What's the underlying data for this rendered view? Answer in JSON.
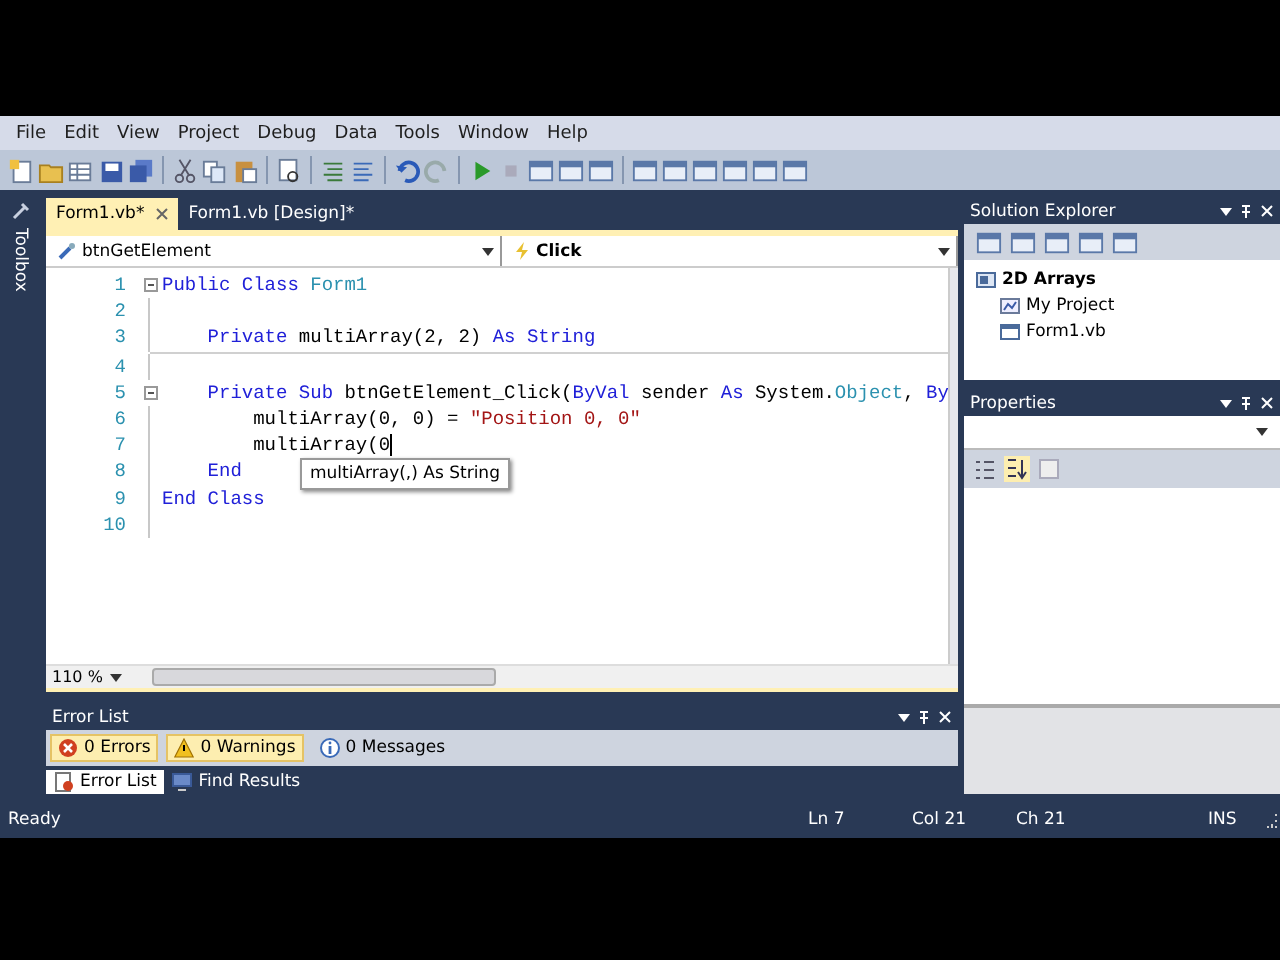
{
  "menu": [
    "File",
    "Edit",
    "View",
    "Project",
    "Debug",
    "Data",
    "Tools",
    "Window",
    "Help"
  ],
  "sidebar": {
    "title": "Toolbox"
  },
  "editor": {
    "tabs": [
      {
        "label": "Form1.vb*",
        "selected": true,
        "closable": true
      },
      {
        "label": "Form1.vb [Design]*",
        "selected": false,
        "closable": false
      }
    ],
    "object_dropdown": "btnGetElement",
    "event_dropdown": "Click",
    "lines": [
      {
        "kind": "code",
        "number": "1",
        "fold": true,
        "tokens": [
          {
            "kind": "keyword",
            "text": "Public Class "
          },
          {
            "kind": "type",
            "text": "Form1"
          }
        ]
      },
      {
        "kind": "code",
        "number": "2",
        "fold": false
      },
      {
        "kind": "code",
        "number": "3",
        "fold": false,
        "tokens": [
          {
            "kind": "keyword",
            "text": "    Private"
          },
          {
            "kind": "plain",
            "text": " multiArray(2, 2) "
          },
          {
            "kind": "keyword",
            "text": "As String"
          }
        ]
      },
      {
        "kind": "separator"
      },
      {
        "kind": "code",
        "number": "4",
        "fold": false
      },
      {
        "kind": "code",
        "number": "5",
        "fold": true,
        "tokens": [
          {
            "kind": "keyword",
            "text": "    Private Sub"
          },
          {
            "kind": "plain",
            "text": " btnGetElement_Click("
          },
          {
            "kind": "keyword",
            "text": "ByVal"
          },
          {
            "kind": "plain",
            "text": " sender "
          },
          {
            "kind": "keyword",
            "text": "As"
          },
          {
            "kind": "plain",
            "text": " System."
          },
          {
            "kind": "type",
            "text": "Object"
          },
          {
            "kind": "plain",
            "text": ", "
          },
          {
            "kind": "keyword",
            "text": "By"
          }
        ]
      },
      {
        "kind": "code",
        "number": "6",
        "fold": false,
        "tokens": [
          {
            "kind": "plain",
            "text": "        multiArray(0, 0) = "
          },
          {
            "kind": "string",
            "text": "\"Position 0, 0\""
          }
        ]
      },
      {
        "kind": "code",
        "number": "7",
        "fold": false,
        "caret": true,
        "tokens": [
          {
            "kind": "plain",
            "text": "        multiArray(0"
          }
        ]
      },
      {
        "kind": "code",
        "number": "8",
        "fold": false,
        "tokens": [
          {
            "kind": "keyword",
            "text": "    End"
          }
        ]
      },
      {
        "kind": "code",
        "number": "9",
        "fold": false,
        "tokens": [
          {
            "kind": "keyword",
            "text": "End Class"
          }
        ]
      },
      {
        "kind": "code",
        "number": "10",
        "fold": false
      }
    ],
    "tooltip": "multiArray(,) As String",
    "zoom": "110 %"
  },
  "error_list": {
    "title": "Error List",
    "filters": [
      {
        "kind": "error",
        "label": "0 Errors",
        "selected": true
      },
      {
        "kind": "warning",
        "label": "0 Warnings",
        "selected": true
      },
      {
        "kind": "info",
        "label": "0 Messages",
        "selected": false
      }
    ],
    "tabs": [
      {
        "kind": "errors",
        "label": "Error List",
        "selected": true
      },
      {
        "kind": "find",
        "label": "Find Results",
        "selected": false
      }
    ]
  },
  "solution_explorer": {
    "title": "Solution Explorer",
    "tree": [
      {
        "label": "2D Arrays",
        "kind": "solution",
        "children": [
          {
            "label": "My Project",
            "kind": "project"
          },
          {
            "label": "Form1.vb",
            "kind": "form"
          }
        ]
      }
    ]
  },
  "properties": {
    "title": "Properties"
  },
  "status_bar": {
    "message": "Ready",
    "line": "Ln 7",
    "column": "Col 21",
    "char": "Ch 21",
    "mode": "INS"
  }
}
